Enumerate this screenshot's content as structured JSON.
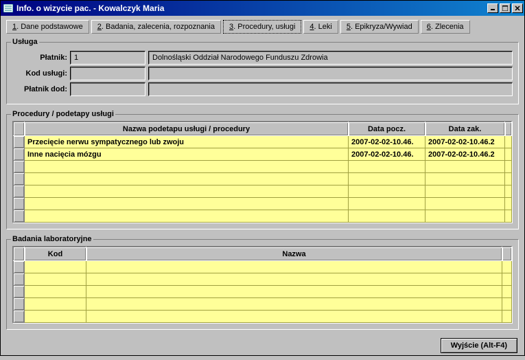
{
  "window": {
    "title": "Info. o wizycie pac.   - Kowalczyk Maria"
  },
  "tabs": [
    {
      "label": "1. Dane podstawowe",
      "underline": "1"
    },
    {
      "label": "2. Badania, zalecenia, rozpoznania",
      "underline": "2"
    },
    {
      "label": "3. Procedury, usługi",
      "underline": "3",
      "active": true
    },
    {
      "label": "4. Leki",
      "underline": "4"
    },
    {
      "label": "5. Epikryza/Wywiad",
      "underline": "5"
    },
    {
      "label": "6. Zlecenia",
      "underline": "6"
    }
  ],
  "usluga": {
    "legend": "Usługa",
    "platnik_label": "Płatnik:",
    "platnik_code": "1",
    "platnik_name": "Dolnośląski Oddział Narodowego Funduszu Zdrowia",
    "kod_label": "Kod usługi:",
    "kod_code": "",
    "kod_name": "",
    "platnikdod_label": "Płatnik dod:",
    "platnikdod_code": "",
    "platnikdod_name": ""
  },
  "procedury": {
    "legend": "Procedury / podetapy usługi",
    "columns": {
      "nazwa": "Nazwa podetapu usługi / procedury",
      "pocz": "Data pocz.",
      "zak": "Data zak."
    },
    "rows": [
      {
        "nazwa": "Przecięcie nerwu sympatycznego lub zwoju",
        "pocz": "2007-02-02-10.46.",
        "zak": "2007-02-02-10.46.2"
      },
      {
        "nazwa": "Inne nacięcia mózgu",
        "pocz": "2007-02-02-10.46.",
        "zak": "2007-02-02-10.46.2"
      }
    ]
  },
  "badania": {
    "legend": "Badania laboratoryjne",
    "columns": {
      "kod": "Kod",
      "nazwa": "Nazwa"
    },
    "rows": []
  },
  "buttons": {
    "exit": "Wyjście (Alt-F4)"
  }
}
